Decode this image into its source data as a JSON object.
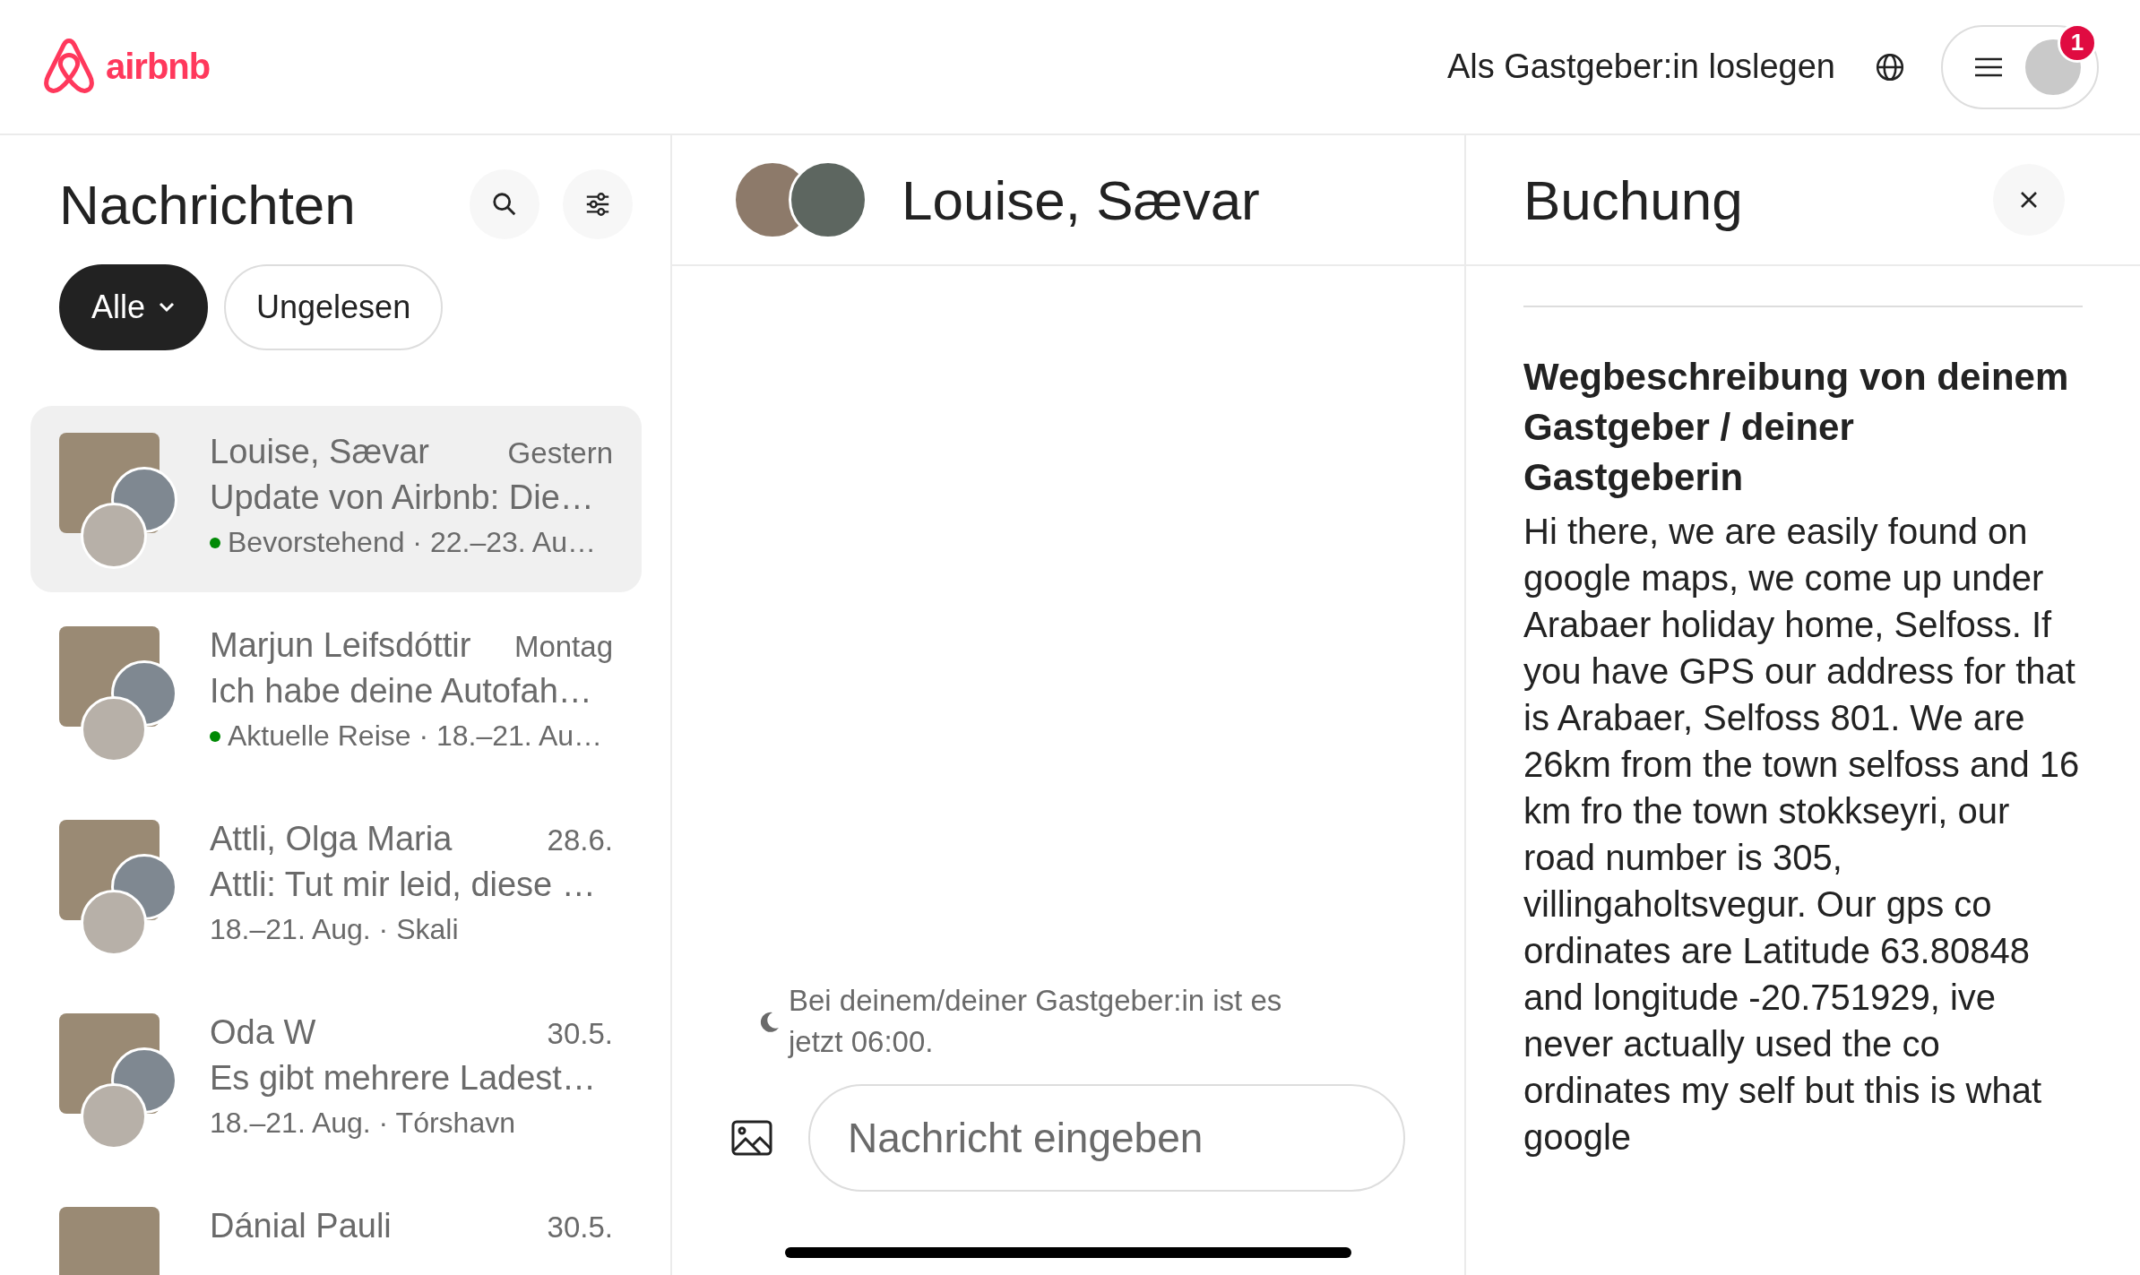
{
  "header": {
    "logo_text": "airbnb",
    "host_link": "Als Gastgeber:in loslegen",
    "notification_count": "1"
  },
  "inbox": {
    "title": "Nachrichten",
    "filters": [
      {
        "label": "Alle",
        "selected": true,
        "kind": "dropdown"
      },
      {
        "label": "Ungelesen",
        "selected": false,
        "kind": "plain"
      }
    ],
    "conversations": [
      {
        "name": "Louise, Sævar",
        "time": "Gestern",
        "preview": "Update von Airbnb: Die…",
        "meta": "Bevorstehend · 22.–23. Au…",
        "dot": true,
        "selected": true
      },
      {
        "name": "Marjun Leifsdóttir",
        "time": "Montag",
        "preview": "Ich habe deine Autofah…",
        "meta": "Aktuelle Reise · 18.–21. Au…",
        "dot": true,
        "selected": false
      },
      {
        "name": "Attli, Olga Maria",
        "time": "28.6.",
        "preview": "Attli: Tut mir leid, diese …",
        "meta": "18.–21. Aug. · Skali",
        "dot": false,
        "selected": false
      },
      {
        "name": "Oda W",
        "time": "30.5.",
        "preview": "Es gibt mehrere Ladest…",
        "meta": "18.–21. Aug. · Tórshavn",
        "dot": false,
        "selected": false
      },
      {
        "name": "Dánial Pauli",
        "time": "30.5.",
        "selected": false
      }
    ]
  },
  "chat": {
    "title": "Louise, Sævar",
    "timezone_note": "Bei deinem/deiner Gastgeber:in ist es jetzt 06:00.",
    "input": {
      "placeholder": "Nachricht eingeben"
    }
  },
  "booking": {
    "title": "Buchung",
    "section_heading": "Wegbeschreibung von deinem Gastgeber / deiner Gastgeberin",
    "body": "Hi there, we are easily found on google maps, we come up under Arabaer holiday home, Selfoss. If you have GPS our address for that is Arabaer, Selfoss 801. We are 26km from the town selfoss and 16 km fro the town stokkseyri, our road number is 305, villingaholtsvegur. Our gps co ordinates are Latitude 63.80848 and longitude -20.751929, ive never actually used the co ordinates my self but this is what google"
  }
}
